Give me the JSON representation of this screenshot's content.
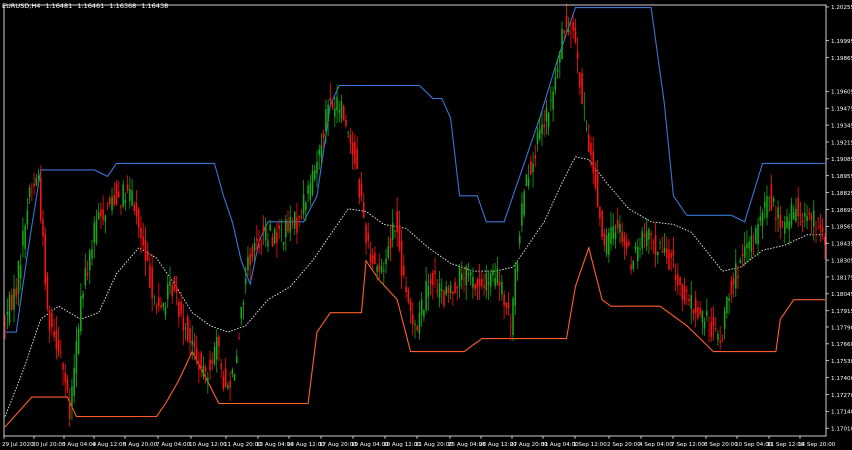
{
  "header": {
    "symbol": "EURUSD,H4",
    "open": "1.16481",
    "high": "1.16461",
    "low": "1.16368",
    "close": "1.16438"
  },
  "colors": {
    "background": "#000000",
    "axis": "#ffffff",
    "upper_band": "#3a74d6",
    "lower_band": "#ff5e2b",
    "moving_average": "#dddddd",
    "bull_candle": "#19a819",
    "bear_candle": "#ff1111"
  },
  "chart_data": {
    "type": "candlestick",
    "title": "",
    "xlabel": "",
    "ylabel": "",
    "ylim": [
      1.1695,
      1.2027
    ],
    "grid": false,
    "y_ticks": [
      "1.20255",
      "1.19995",
      "1.19865",
      "1.19605",
      "1.19475",
      "1.19345",
      "1.19215",
      "1.19085",
      "1.18955",
      "1.18825",
      "1.18695",
      "1.18565",
      "1.18435",
      "1.18305",
      "1.18175",
      "1.18045",
      "1.17915",
      "1.17790",
      "1.17660",
      "1.17530",
      "1.17400",
      "1.17270",
      "1.17140",
      "1.17010"
    ],
    "x_ticks": [
      "29 Jul 2020",
      "30 Jul 20:00",
      "3 Aug 04:00",
      "4 Aug 12:00",
      "5 Aug 20:00",
      "7 Aug 04:00",
      "10 Aug 12:00",
      "11 Aug 20:00",
      "13 Aug 04:00",
      "14 Aug 12:00",
      "17 Aug 20:00",
      "19 Aug 04:00",
      "20 Aug 12:00",
      "21 Aug 20:00",
      "25 Aug 04:00",
      "26 Aug 12:00",
      "27 Aug 20:00",
      "31 Aug 04:00",
      "1 Sep 12:00",
      "2 Sep 20:00",
      "4 Sep 04:00",
      "7 Sep 12:00",
      "8 Sep 20:00",
      "10 Sep 04:00",
      "11 Sep 12:00",
      "14 Sep 20:00"
    ],
    "price_keypoints": [
      [
        0,
        1.178
      ],
      [
        6,
        1.181
      ],
      [
        12,
        1.1885
      ],
      [
        16,
        1.1895
      ],
      [
        20,
        1.179
      ],
      [
        26,
        1.176
      ],
      [
        30,
        1.171
      ],
      [
        35,
        1.18
      ],
      [
        42,
        1.186
      ],
      [
        50,
        1.188
      ],
      [
        58,
        1.188
      ],
      [
        64,
        1.183
      ],
      [
        70,
        1.179
      ],
      [
        76,
        1.181
      ],
      [
        84,
        1.177
      ],
      [
        90,
        1.174
      ],
      [
        96,
        1.1765
      ],
      [
        100,
        1.173
      ],
      [
        104,
        1.175
      ],
      [
        110,
        1.183
      ],
      [
        116,
        1.185
      ],
      [
        124,
        1.185
      ],
      [
        132,
        1.186
      ],
      [
        140,
        1.19
      ],
      [
        146,
        1.195
      ],
      [
        152,
        1.1948
      ],
      [
        158,
        1.191
      ],
      [
        164,
        1.184
      ],
      [
        170,
        1.182
      ],
      [
        176,
        1.1862
      ],
      [
        181,
        1.18
      ],
      [
        186,
        1.178
      ],
      [
        192,
        1.182
      ],
      [
        198,
        1.18
      ],
      [
        206,
        1.182
      ],
      [
        214,
        1.181
      ],
      [
        222,
        1.1818
      ],
      [
        228,
        1.178
      ],
      [
        234,
        1.189
      ],
      [
        240,
        1.192
      ],
      [
        246,
        1.195
      ],
      [
        252,
        1.201
      ],
      [
        256,
        1.2015
      ],
      [
        260,
        1.195
      ],
      [
        265,
        1.19
      ],
      [
        270,
        1.184
      ],
      [
        276,
        1.186
      ],
      [
        282,
        1.183
      ],
      [
        288,
        1.185
      ],
      [
        294,
        1.184
      ],
      [
        300,
        1.183
      ],
      [
        306,
        1.18
      ],
      [
        312,
        1.179
      ],
      [
        318,
        1.178
      ],
      [
        322,
        1.1765
      ],
      [
        326,
        1.181
      ],
      [
        332,
        1.183
      ],
      [
        338,
        1.185
      ],
      [
        344,
        1.188
      ],
      [
        350,
        1.1855
      ],
      [
        356,
        1.187
      ],
      [
        362,
        1.1865
      ],
      [
        368,
        1.185
      ]
    ],
    "upper_band_points": [
      [
        0,
        1.1775
      ],
      [
        5,
        1.1775
      ],
      [
        10,
        1.1835
      ],
      [
        16,
        1.19
      ],
      [
        40,
        1.19
      ],
      [
        46,
        1.1895
      ],
      [
        50,
        1.1905
      ],
      [
        70,
        1.1905
      ],
      [
        94,
        1.1905
      ],
      [
        98,
        1.188
      ],
      [
        102,
        1.186
      ],
      [
        106,
        1.183
      ],
      [
        110,
        1.1812
      ],
      [
        114,
        1.1845
      ],
      [
        118,
        1.186
      ],
      [
        126,
        1.186
      ],
      [
        134,
        1.186
      ],
      [
        140,
        1.188
      ],
      [
        146,
        1.195
      ],
      [
        150,
        1.1965
      ],
      [
        170,
        1.1965
      ],
      [
        186,
        1.1965
      ],
      [
        192,
        1.1955
      ],
      [
        196,
        1.1955
      ],
      [
        200,
        1.194
      ],
      [
        204,
        1.188
      ],
      [
        212,
        1.188
      ],
      [
        216,
        1.186
      ],
      [
        224,
        1.186
      ],
      [
        230,
        1.189
      ],
      [
        240,
        1.194
      ],
      [
        248,
        1.1985
      ],
      [
        256,
        1.2025
      ],
      [
        290,
        1.2025
      ],
      [
        296,
        1.195
      ],
      [
        300,
        1.188
      ],
      [
        306,
        1.1865
      ],
      [
        326,
        1.1865
      ],
      [
        332,
        1.186
      ],
      [
        340,
        1.1905
      ],
      [
        368,
        1.1905
      ]
    ],
    "lower_band_points": [
      [
        0,
        1.1702
      ],
      [
        12,
        1.1725
      ],
      [
        28,
        1.1725
      ],
      [
        32,
        1.171
      ],
      [
        68,
        1.171
      ],
      [
        72,
        1.172
      ],
      [
        78,
        1.1738
      ],
      [
        84,
        1.176
      ],
      [
        90,
        1.174
      ],
      [
        96,
        1.172
      ],
      [
        102,
        1.172
      ],
      [
        136,
        1.172
      ],
      [
        140,
        1.1775
      ],
      [
        146,
        1.179
      ],
      [
        160,
        1.179
      ],
      [
        162,
        1.183
      ],
      [
        168,
        1.1815
      ],
      [
        176,
        1.18
      ],
      [
        182,
        1.176
      ],
      [
        186,
        1.176
      ],
      [
        206,
        1.176
      ],
      [
        214,
        1.177
      ],
      [
        240,
        1.177
      ],
      [
        252,
        1.177
      ],
      [
        256,
        1.181
      ],
      [
        262,
        1.184
      ],
      [
        268,
        1.18
      ],
      [
        272,
        1.1795
      ],
      [
        294,
        1.1795
      ],
      [
        306,
        1.178
      ],
      [
        318,
        1.176
      ],
      [
        346,
        1.176
      ],
      [
        348,
        1.1785
      ],
      [
        354,
        1.18
      ],
      [
        368,
        1.18
      ]
    ],
    "ma_points": [
      [
        0,
        1.171
      ],
      [
        8,
        1.1745
      ],
      [
        16,
        1.1785
      ],
      [
        24,
        1.1795
      ],
      [
        34,
        1.1785
      ],
      [
        42,
        1.179
      ],
      [
        50,
        1.182
      ],
      [
        60,
        1.184
      ],
      [
        68,
        1.1832
      ],
      [
        76,
        1.1812
      ],
      [
        84,
        1.179
      ],
      [
        92,
        1.178
      ],
      [
        100,
        1.1775
      ],
      [
        108,
        1.178
      ],
      [
        118,
        1.18
      ],
      [
        128,
        1.181
      ],
      [
        138,
        1.183
      ],
      [
        146,
        1.185
      ],
      [
        154,
        1.187
      ],
      [
        162,
        1.1868
      ],
      [
        170,
        1.1858
      ],
      [
        180,
        1.1855
      ],
      [
        190,
        1.184
      ],
      [
        200,
        1.1828
      ],
      [
        210,
        1.1822
      ],
      [
        220,
        1.1822
      ],
      [
        228,
        1.1825
      ],
      [
        234,
        1.184
      ],
      [
        242,
        1.186
      ],
      [
        250,
        1.189
      ],
      [
        256,
        1.191
      ],
      [
        262,
        1.1908
      ],
      [
        270,
        1.189
      ],
      [
        280,
        1.187
      ],
      [
        290,
        1.186
      ],
      [
        300,
        1.1858
      ],
      [
        308,
        1.1852
      ],
      [
        316,
        1.1835
      ],
      [
        322,
        1.1822
      ],
      [
        330,
        1.1825
      ],
      [
        340,
        1.1838
      ],
      [
        350,
        1.1842
      ],
      [
        360,
        1.185
      ],
      [
        368,
        1.185
      ]
    ]
  }
}
